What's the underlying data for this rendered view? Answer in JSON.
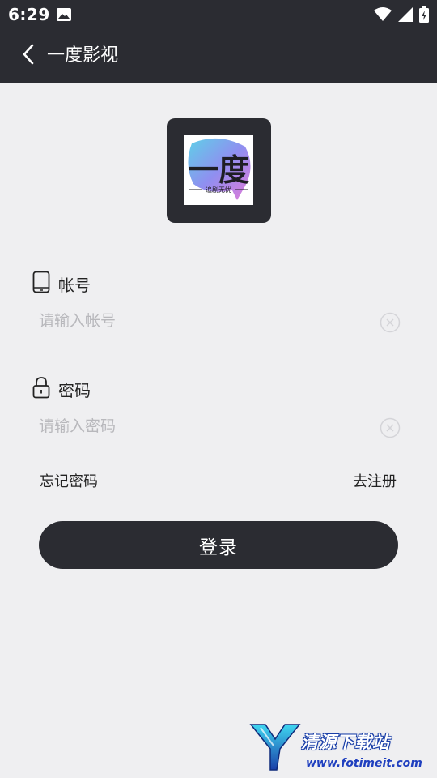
{
  "status_bar": {
    "time": "6:29"
  },
  "app_bar": {
    "title": "一度影视"
  },
  "logo": {
    "main_text": "一度",
    "sub_text": "追剧无忧"
  },
  "account": {
    "label": "帐号",
    "placeholder": "请输入帐号",
    "value": ""
  },
  "password": {
    "label": "密码",
    "placeholder": "请输入密码",
    "value": ""
  },
  "links": {
    "forgot_password": "忘记密码",
    "register": "去注册"
  },
  "login_button": {
    "label": "登录"
  },
  "watermark": {
    "text": "清源下载站",
    "url": "www.fotimeit.com"
  },
  "colors": {
    "dark": "#2b2c32",
    "background": "#efeff1",
    "placeholder": "#b8b8bc"
  }
}
